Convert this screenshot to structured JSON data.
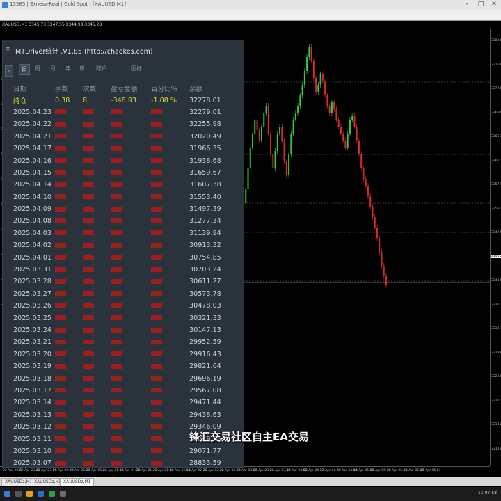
{
  "window": {
    "title": "13585 | Exness-Real | Gold Spot | [XAUUSD,M1]",
    "symbol_info": "XAUUSD,M1 3345.73 3347.55 3344.98 3345.28"
  },
  "panel": {
    "title": "MTDriver统计 ,V1.85 (http://chaokes.com)",
    "tabs": [
      "日",
      "周",
      "月",
      "年",
      "币",
      "账户",
      "图标"
    ],
    "columns": [
      "日期",
      "手数",
      "次数",
      "盈亏金额",
      "百分比%",
      "余额"
    ],
    "summary": {
      "label": "持仓",
      "lots": "0.38",
      "count": "8",
      "pnl": "-348.93",
      "pct": "-1.08 %",
      "balance": "32278.01"
    },
    "rows": [
      {
        "date": "2025.04.23",
        "balance": "32279.01"
      },
      {
        "date": "2025.04.22",
        "balance": "32255.98"
      },
      {
        "date": "2025.04.21",
        "balance": "32020.49"
      },
      {
        "date": "2025.04.17",
        "balance": "31966.35"
      },
      {
        "date": "2025.04.16",
        "balance": "31938.68"
      },
      {
        "date": "2025.04.15",
        "balance": "31659.67"
      },
      {
        "date": "2025.04.14",
        "balance": "31607.38"
      },
      {
        "date": "2025.04.10",
        "balance": "31553.40"
      },
      {
        "date": "2025.04.09",
        "balance": "31497.39"
      },
      {
        "date": "2025.04.08",
        "balance": "31277.34"
      },
      {
        "date": "2025.04.03",
        "balance": "31139.94"
      },
      {
        "date": "2025.04.02",
        "balance": "30913.32"
      },
      {
        "date": "2025.04.01",
        "balance": "30754.85"
      },
      {
        "date": "2025.03.31",
        "balance": "30703.24"
      },
      {
        "date": "2025.03.28",
        "balance": "30611.27"
      },
      {
        "date": "2025.03.27",
        "balance": "30573.78"
      },
      {
        "date": "2025.03.26",
        "balance": "30478.03"
      },
      {
        "date": "2025.03.25",
        "balance": "30321.33"
      },
      {
        "date": "2025.03.24",
        "balance": "30147.13"
      },
      {
        "date": "2025.03.21",
        "balance": "29952.59"
      },
      {
        "date": "2025.03.20",
        "balance": "29916.43"
      },
      {
        "date": "2025.03.19",
        "balance": "29821.64"
      },
      {
        "date": "2025.03.18",
        "balance": "29696.19"
      },
      {
        "date": "2025.03.17",
        "balance": "29567.08"
      },
      {
        "date": "2025.03.14",
        "balance": "29471.44"
      },
      {
        "date": "2025.03.13",
        "balance": "29438.63"
      },
      {
        "date": "2025.03.12",
        "balance": "29346.09"
      },
      {
        "date": "2025.03.11",
        "balance": "29229.36"
      },
      {
        "date": "2025.03.10",
        "balance": "29071.77"
      },
      {
        "date": "2025.03.07",
        "balance": "28833.59"
      }
    ]
  },
  "subtitle": "锋汇交易社区自主EA交易",
  "time_axis": [
    "22 Apr 2025",
    "22 Apr 23:40",
    "22 Apr 23:56",
    "23 Apr 00:12",
    "23 Apr 00:28",
    "23 Apr 00:44",
    "23 Apr 01:00",
    "23 Apr 01:16",
    "23 Apr 01:32",
    "23 Apr 01:48",
    "23 Apr 02:04",
    "23 Apr 02:20",
    "23 Apr 02:36",
    "23 Apr 02:52",
    "23 Apr 03:08",
    "23 Apr 03:24",
    "23 Apr 03:40",
    "23 Apr 03:56",
    "23 Apr 04:12",
    "23 Apr 04:28",
    "23 Apr 04:44",
    "23 Apr 05:00",
    "23 Apr 05:16",
    "23 Apr 05:32",
    "23 Apr 05:48",
    "23 Apr 06:04"
  ],
  "price_axis": [
    "3380.65",
    "3376.66",
    "3372.88",
    "3368.89",
    "3365.10",
    "3361.11",
    "3357.32",
    "3353.33",
    "3349.54",
    "3345.73",
    "3341.56",
    "3337.77",
    "3333.78",
    "3329.99",
    "3326.00",
    "3322.21",
    "3318.22",
    "3314.43"
  ],
  "current_price": "3345.28",
  "tabs": [
    "XAUUSDz,M1",
    "XAUUSDz,H1",
    "XAUUSDz,M1"
  ],
  "clock": "11:07:58",
  "colors": {
    "bull": "#2ecc40",
    "bear": "#d92b2b",
    "panel_bg": "#2c343e",
    "summary": "#d4d836",
    "red_value": "#b52424"
  }
}
